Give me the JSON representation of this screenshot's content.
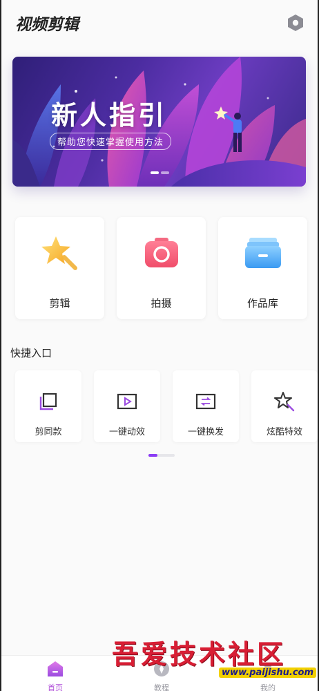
{
  "header": {
    "app_title": "视频剪辑",
    "settings_icon": "settings-hexagon-icon"
  },
  "banner": {
    "headline": "新人指引",
    "subtitle": "帮助您快速掌握使用方法",
    "page_count": 2,
    "active_page": 1
  },
  "main_cards": [
    {
      "label": "剪辑",
      "icon": "star-wand-icon"
    },
    {
      "label": "拍摄",
      "icon": "camera-icon"
    },
    {
      "label": "作品库",
      "icon": "folder-icon"
    }
  ],
  "quick_entry": {
    "title": "快捷入口",
    "items": [
      {
        "label": "剪同款",
        "icon": "copy-layers-icon"
      },
      {
        "label": "一键动效",
        "icon": "play-frame-icon"
      },
      {
        "label": "一键换发",
        "icon": "swap-frame-icon"
      },
      {
        "label": "炫酷特效",
        "icon": "magic-star-icon"
      }
    ],
    "scroll_progress": 0.34
  },
  "bottom_nav": [
    {
      "label": "首页",
      "icon": "home-icon",
      "active": true
    },
    {
      "label": "教程",
      "icon": "compass-icon",
      "active": false
    },
    {
      "label": "我的",
      "icon": "profile-icon",
      "active": false
    }
  ],
  "watermark": {
    "text": "吾爱技术社区",
    "url": "www.paijishu.com"
  },
  "colors": {
    "accent": "#8b3cf5",
    "nav_active": "#b04fd8",
    "watermark_red": "#d81e34"
  }
}
